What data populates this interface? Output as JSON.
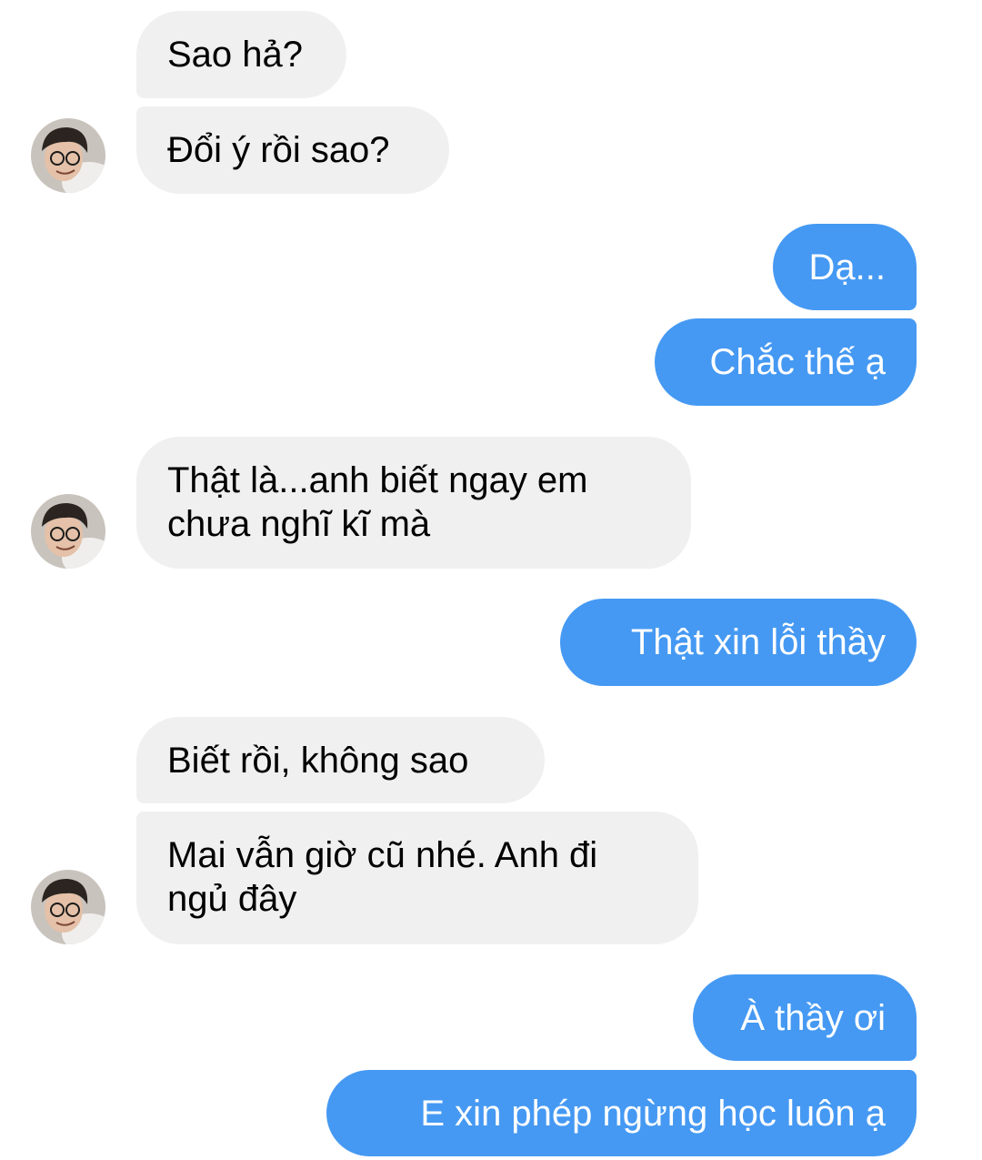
{
  "colors": {
    "incoming_bubble": "#f1f0f0",
    "outgoing_bubble": "#4599f3",
    "incoming_text": "#000000",
    "outgoing_text": "#ffffff"
  },
  "messages": [
    {
      "sender": "other",
      "text": "Sao hả?"
    },
    {
      "sender": "other",
      "text": "Đổi ý rồi sao?"
    },
    {
      "sender": "me",
      "text": "Dạ..."
    },
    {
      "sender": "me",
      "text": "Chắc thế ạ"
    },
    {
      "sender": "other",
      "text": "Thật là...anh biết ngay em\nchưa nghĩ kĩ mà"
    },
    {
      "sender": "me",
      "text": "Thật xin lỗi thầy"
    },
    {
      "sender": "other",
      "text": "Biết rồi, không sao"
    },
    {
      "sender": "other",
      "text": "Mai vẫn giờ cũ nhé. Anh đi\nngủ đây"
    },
    {
      "sender": "me",
      "text": "À thầy ơi"
    },
    {
      "sender": "me",
      "text": "E xin phép ngừng học luôn ạ"
    }
  ],
  "avatars": [
    {
      "icon": "contact-avatar-photo"
    },
    {
      "icon": "contact-avatar-photo"
    },
    {
      "icon": "contact-avatar-photo"
    }
  ]
}
